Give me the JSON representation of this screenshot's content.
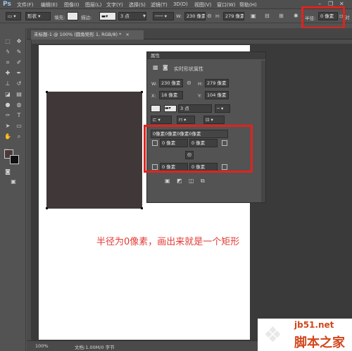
{
  "menubar": {
    "logo": "Ps",
    "items": [
      "文件(F)",
      "编辑(E)",
      "图像(I)",
      "图层(L)",
      "文字(Y)",
      "选择(S)",
      "滤镜(T)",
      "3D(D)",
      "视图(V)",
      "窗口(W)",
      "帮助(H)"
    ]
  },
  "options": {
    "mode": "形状",
    "fill_label": "填充:",
    "stroke_label": "描边:",
    "stroke_width": "3 点",
    "w_label": "W:",
    "w_value": "230 像素",
    "h_label": "H:",
    "h_value": "279 像素",
    "radius_label": "半径:",
    "radius_value": "0 像素",
    "align_edges": "对"
  },
  "document": {
    "tab_title": "未标题-1 @ 100% (圆角矩形 1, RGB/8) *",
    "tab_close": "×",
    "zoom": "100%",
    "doc_info": "文档:1.00M/0 字节"
  },
  "properties": {
    "panel_title": "属性",
    "section": "实时形状属性",
    "w_label": "W:",
    "w_value": "230 像素",
    "h_label": "H:",
    "h_value": "279 像素",
    "x_label": "X:",
    "x_value": "18 像素",
    "y_label": "Y:",
    "y_value": "104 像素",
    "stroke_width": "3 点",
    "corners_all": "0像素0像素0像素0像素",
    "corner_tl": "0 像素",
    "corner_tr": "0 像素",
    "corner_bl": "0 像素",
    "corner_br": "0 像素"
  },
  "annotation": {
    "text": "半径为0像素，画出来就是一个矩形",
    "color": "#e33a35"
  },
  "watermark": {
    "site": "jb51.net",
    "brand": "脚本之家"
  },
  "colors": {
    "shape_fill": "#403838",
    "highlight": "#e0231e",
    "foreground": "#4a3b3b",
    "background": "#ffffff"
  }
}
